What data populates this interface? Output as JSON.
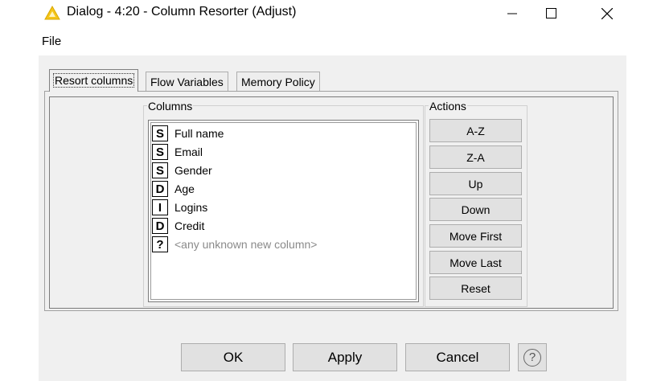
{
  "window": {
    "title": "Dialog - 4:20 - Column Resorter (Adjust)"
  },
  "menu": {
    "file": "File"
  },
  "tabs": [
    {
      "label": "Resort columns"
    },
    {
      "label": "Flow Variables"
    },
    {
      "label": "Memory Policy"
    }
  ],
  "columns_group": {
    "title": "Columns",
    "items": [
      {
        "type": "S",
        "label": "Full name"
      },
      {
        "type": "S",
        "label": "Email"
      },
      {
        "type": "S",
        "label": "Gender"
      },
      {
        "type": "D",
        "label": "Age"
      },
      {
        "type": "I",
        "label": "Logins"
      },
      {
        "type": "D",
        "label": "Credit"
      },
      {
        "type": "?",
        "label": "<any unknown new column>"
      }
    ]
  },
  "actions_group": {
    "title": "Actions",
    "buttons": [
      "A-Z",
      "Z-A",
      "Up",
      "Down",
      "Move First",
      "Move Last",
      "Reset"
    ]
  },
  "footer": {
    "ok": "OK",
    "apply": "Apply",
    "cancel": "Cancel",
    "help": "?"
  },
  "colors": {
    "dialog_bg": "#f0f0f0",
    "button_bg": "#e1e1e1",
    "app_icon": "#f5c518"
  }
}
